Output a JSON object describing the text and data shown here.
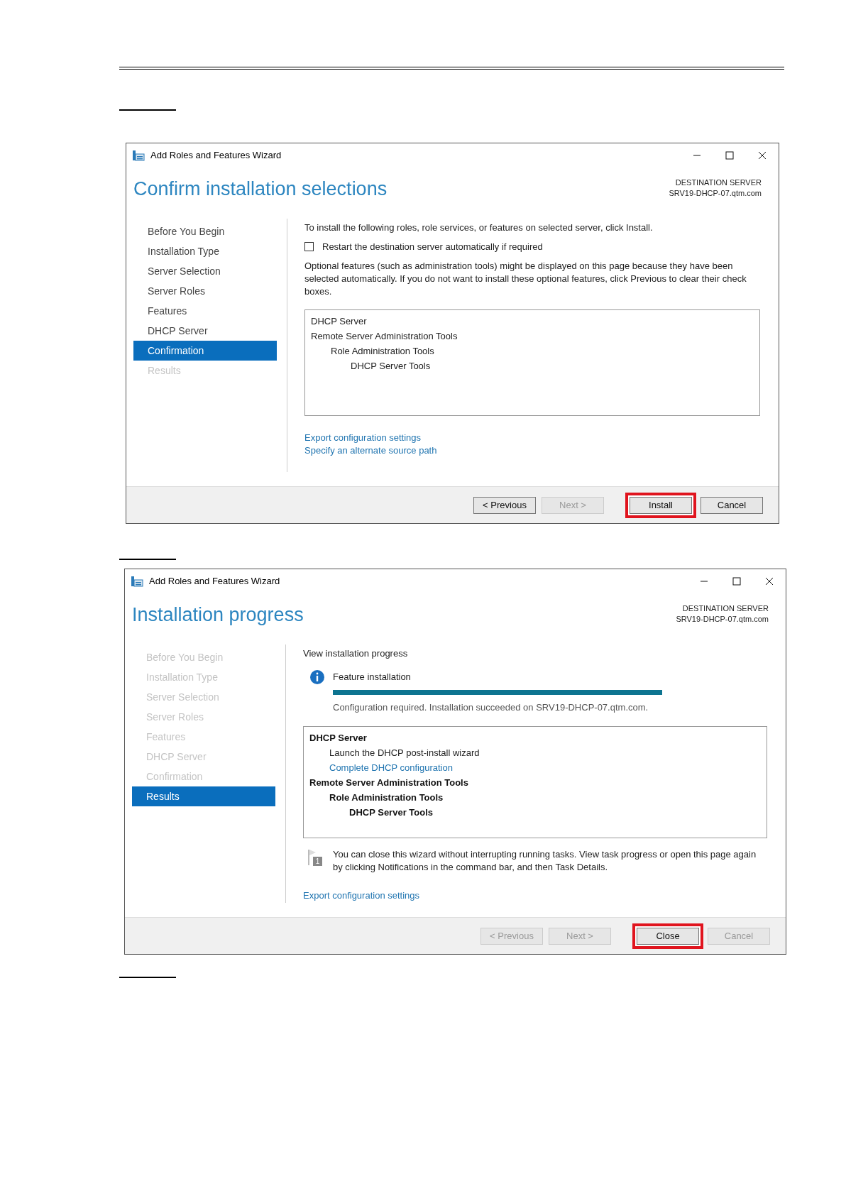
{
  "wizards": [
    {
      "title": "Add Roles and Features Wizard",
      "heading": "Confirm installation selections",
      "destination_label": "DESTINATION SERVER",
      "destination_server": "SRV19-DHCP-07.qtm.com",
      "steps": [
        {
          "label": "Before You Begin",
          "selected": false,
          "disabled": false
        },
        {
          "label": "Installation Type",
          "selected": false,
          "disabled": false
        },
        {
          "label": "Server Selection",
          "selected": false,
          "disabled": false
        },
        {
          "label": "Server Roles",
          "selected": false,
          "disabled": false
        },
        {
          "label": "Features",
          "selected": false,
          "disabled": false
        },
        {
          "label": "DHCP Server",
          "selected": false,
          "disabled": false
        },
        {
          "label": "Confirmation",
          "selected": true,
          "disabled": false
        },
        {
          "label": "Results",
          "selected": false,
          "disabled": true
        }
      ],
      "content": [
        {
          "kind": "text",
          "text": "To install the following roles, role services, or features on selected server, click Install."
        },
        {
          "kind": "checkbox",
          "label": "Restart the destination server automatically if required",
          "checked": false
        },
        {
          "kind": "text",
          "text": "Optional features (such as administration tools) might be displayed on this page because they have been selected automatically. If you do not want to install these optional features, click Previous to clear their check boxes."
        },
        {
          "kind": "listbox",
          "items": [
            {
              "kind": "plain",
              "label": "DHCP Server"
            },
            {
              "kind": "plain",
              "label": "Remote Server Administration Tools",
              "children": [
                {
                  "kind": "plain",
                  "label": "Role Administration Tools",
                  "children": [
                    {
                      "kind": "plain",
                      "label": "DHCP Server Tools"
                    }
                  ]
                }
              ]
            }
          ]
        },
        {
          "kind": "links",
          "links": [
            "Export configuration settings",
            "Specify an alternate source path"
          ]
        }
      ],
      "buttons": [
        {
          "label": "< Previous",
          "disabled": false,
          "highlighted": false
        },
        {
          "label": "Next >",
          "disabled": true,
          "highlighted": false
        },
        {
          "label": "Install",
          "disabled": false,
          "highlighted": true
        },
        {
          "label": "Cancel",
          "disabled": false,
          "highlighted": false
        }
      ]
    },
    {
      "title": "Add Roles and Features Wizard",
      "heading": "Installation progress",
      "destination_label": "DESTINATION SERVER",
      "destination_server": "SRV19-DHCP-07.qtm.com",
      "steps": [
        {
          "label": "Before You Begin",
          "selected": false,
          "disabled": true
        },
        {
          "label": "Installation Type",
          "selected": false,
          "disabled": true
        },
        {
          "label": "Server Selection",
          "selected": false,
          "disabled": true
        },
        {
          "label": "Server Roles",
          "selected": false,
          "disabled": true
        },
        {
          "label": "Features",
          "selected": false,
          "disabled": true
        },
        {
          "label": "DHCP Server",
          "selected": false,
          "disabled": true
        },
        {
          "label": "Confirmation",
          "selected": false,
          "disabled": true
        },
        {
          "label": "Results",
          "selected": true,
          "disabled": false
        }
      ],
      "content": [
        {
          "kind": "text",
          "text": "View installation progress"
        },
        {
          "kind": "progress",
          "label": "Feature installation",
          "level": 1,
          "status": "Configuration required. Installation succeeded on SRV19-DHCP-07.qtm.com."
        },
        {
          "kind": "listbox",
          "items": [
            {
              "kind": "bold",
              "label": "DHCP Server",
              "children": [
                {
                  "kind": "plain",
                  "label": "Launch the DHCP post-install wizard"
                },
                {
                  "kind": "link",
                  "label": "Complete DHCP configuration"
                }
              ]
            },
            {
              "kind": "bold",
              "label": "Remote Server Administration Tools",
              "children": [
                {
                  "kind": "bold",
                  "label": "Role Administration Tools",
                  "children": [
                    {
                      "kind": "bold",
                      "label": "DHCP Server Tools"
                    }
                  ]
                }
              ]
            }
          ]
        },
        {
          "kind": "notice",
          "icon_text": "1",
          "text": "You can close this wizard without interrupting running tasks. View task progress or open this page again by clicking Notifications in the command bar, and then Task Details."
        },
        {
          "kind": "links",
          "links": [
            "Export configuration settings"
          ]
        }
      ],
      "buttons": [
        {
          "label": "< Previous",
          "disabled": true,
          "highlighted": false
        },
        {
          "label": "Next >",
          "disabled": true,
          "highlighted": false
        },
        {
          "label": "Close",
          "disabled": false,
          "highlighted": true
        },
        {
          "label": "Cancel",
          "disabled": true,
          "highlighted": false
        }
      ]
    }
  ]
}
